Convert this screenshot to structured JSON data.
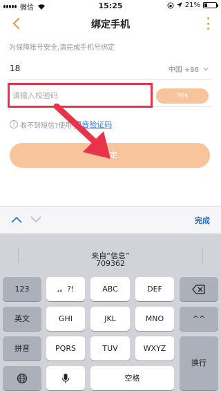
{
  "status": {
    "carrier": "微信",
    "time": "15:25",
    "battery_text": "21%",
    "battery_level": 0.21
  },
  "nav": {
    "title": "绑定手机",
    "back_icon": "chevron-left-icon",
    "more_icon": "more-vertical-icon",
    "accent": "#e5a040"
  },
  "form": {
    "hint": "为保障账号安全,请完成手机号绑定",
    "phone_value": "18",
    "country": "中国 +86",
    "code_placeholder": "请输入校验码",
    "countdown": "50s",
    "no_sms_text": "收不到短信?使用",
    "voice_link": "语音验证码",
    "bind_button": "绑定",
    "button_color": "#f8c49c"
  },
  "keyboard": {
    "done": "完成",
    "suggestion_title": "来自“信息”",
    "suggestion_code": "709362",
    "keys": {
      "k123": "123",
      "punct": ",。?!",
      "abc": "ABC",
      "def": "DEF",
      "english": "英文",
      "ghi": "GHI",
      "jkl": "JKL",
      "mno": "MNO",
      "emoticon": "^^",
      "pinyin": "拼音",
      "pqrs": "PQRS",
      "tuv": "TUV",
      "wxyz": "WXYZ",
      "return": "换行",
      "space": "空格"
    }
  }
}
